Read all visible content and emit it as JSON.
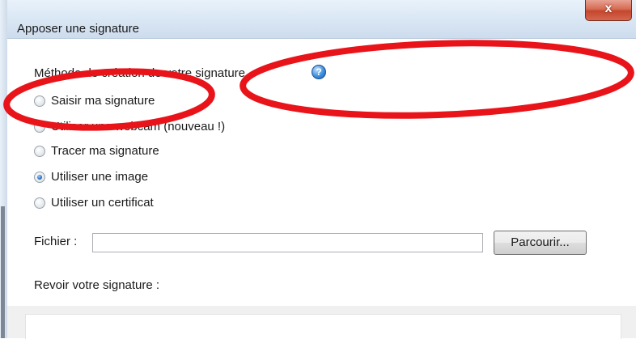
{
  "dialog": {
    "title": "Apposer une signature",
    "close_label": "x"
  },
  "method": {
    "label": "Méthode de création de votre signature",
    "help_icon": "help-icon",
    "options": [
      {
        "label": "Saisir ma signature",
        "checked": false
      },
      {
        "label": "Utiliser une webcam (nouveau !)",
        "checked": false
      },
      {
        "label": "Tracer ma signature",
        "checked": false
      },
      {
        "label": "Utiliser une image",
        "checked": true
      },
      {
        "label": "Utiliser un certificat",
        "checked": false
      }
    ]
  },
  "file": {
    "label": "Fichier :",
    "value": "",
    "browse_label": "Parcourir..."
  },
  "review": {
    "label": "Revoir votre signature :"
  },
  "colors": {
    "annotation": "#e8141a",
    "help": "#3d8fe0"
  }
}
